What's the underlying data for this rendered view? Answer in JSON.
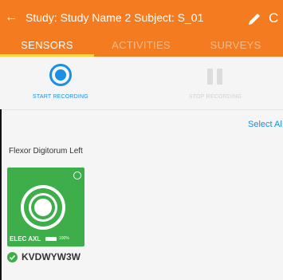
{
  "appbar": {
    "title": "Study: Study Name 2  Subject: S_01",
    "back_icon": "arrow-left-icon",
    "edit_icon": "pencil-icon",
    "refresh_icon": "refresh-icon",
    "back_glyph": "←",
    "refresh_glyph": "C"
  },
  "tabs": [
    {
      "label": "SENSORS",
      "active": true
    },
    {
      "label": "ACTIVITIES",
      "active": false
    },
    {
      "label": "SURVEYS",
      "active": false
    }
  ],
  "recording": {
    "start_label": "START RECORDING",
    "stop_label": "STOP RECORDING"
  },
  "select_all_label": "Select Al",
  "location_label": "Flexor Digitorum Left",
  "sensor": {
    "type": "ELEC AXL",
    "battery": "100%",
    "device_id": "KVDWYW3W",
    "connected": true
  },
  "colors": {
    "primary": "#f47b1f",
    "accent": "#1a8fe3",
    "tab_indicator": "#ffd23f",
    "sensor_card": "#3dae49"
  }
}
